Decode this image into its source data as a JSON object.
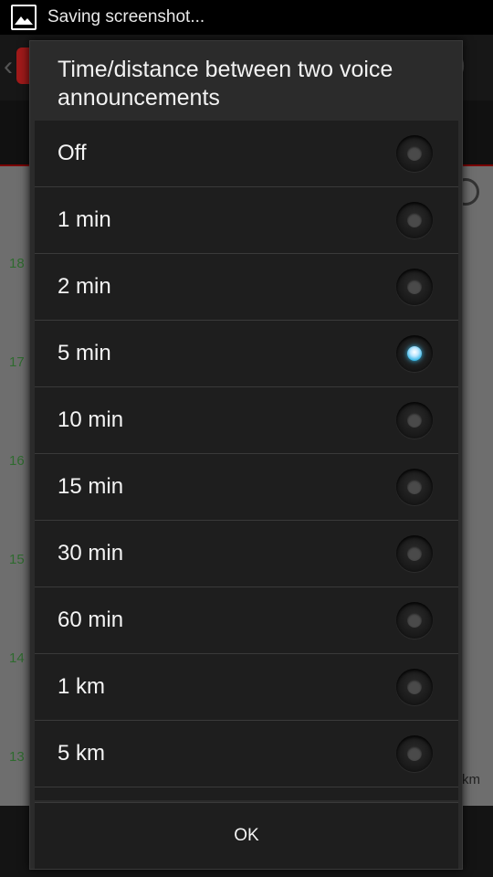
{
  "statusbar": {
    "text": "Saving screenshot..."
  },
  "background": {
    "ticks": [
      "18",
      "17",
      "16",
      "15",
      "14",
      "13"
    ],
    "km_label": "km"
  },
  "dialog": {
    "title": "Time/distance between two voice announcements",
    "options": [
      {
        "label": "Off",
        "checked": false
      },
      {
        "label": "1 min",
        "checked": false
      },
      {
        "label": "2 min",
        "checked": false
      },
      {
        "label": "5 min",
        "checked": true
      },
      {
        "label": "10 min",
        "checked": false
      },
      {
        "label": "15 min",
        "checked": false
      },
      {
        "label": "30 min",
        "checked": false
      },
      {
        "label": "60 min",
        "checked": false
      },
      {
        "label": "1 km",
        "checked": false
      },
      {
        "label": "5 km",
        "checked": false
      }
    ],
    "ok_label": "OK"
  },
  "colors": {
    "accent": "#33b5e5",
    "dialog_bg": "#1e1e1e"
  }
}
